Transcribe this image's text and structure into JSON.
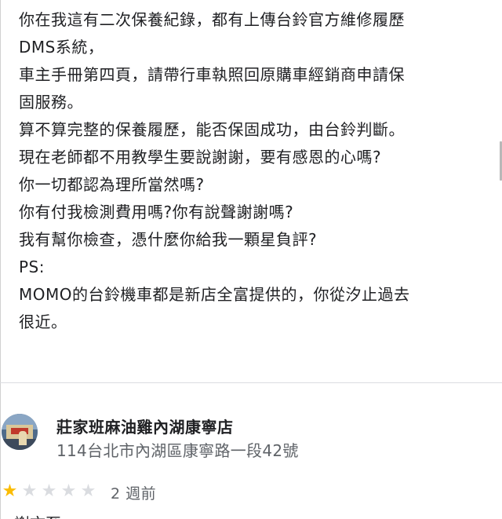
{
  "review": {
    "lines": [
      "你在我這有二次保養紀錄，都有上傳台鈴官方維修履歷",
      "DMS系統，",
      "車主手冊第四頁，請帶行車執照回原購車經銷商申請保",
      "固服務。",
      "算不算完整的保養履歷，能否保固成功，由台鈴判斷。",
      "現在老師都不用教學生要說謝謝，要有感恩的心嗎?",
      "你一切都認為理所當然嗎?",
      "你有付我檢測費用嗎?你有說聲謝謝嗎?",
      "我有幫你檢查，憑什麼你給我一顆星負評?",
      "PS:",
      "MOMO的台鈴機車都是新店全富提供的，你從汐止過去",
      "很近。"
    ]
  },
  "reviewer": {
    "name": "莊家班麻油雞內湖康寧店",
    "address": "114台北市內湖區康寧路一段42號",
    "avatar_icon": "storefront-avatar"
  },
  "rating": {
    "stars": 1,
    "max_stars": 5,
    "filled_color": "#fbbc04",
    "empty_color": "#dadce0",
    "date": "2 週前"
  },
  "next_review": {
    "partial_text": "謝文至"
  }
}
